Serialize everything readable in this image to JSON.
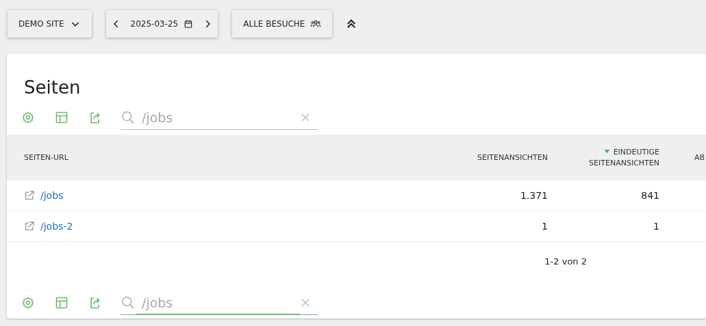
{
  "top_bar": {
    "site_button": "DEMO SITE",
    "date": "2025-03-25",
    "segment_button": "ALLE BESUCHE"
  },
  "card": {
    "title": "Seiten",
    "top_search": {
      "value": "/jobs",
      "focused": false
    },
    "table": {
      "columns": [
        {
          "label": "SEITEN-URL",
          "sorted": false
        },
        {
          "label": "SEITENANSICHTEN",
          "sorted": false
        },
        {
          "label": "EINDEUTIGE SEITENANSICHTEN",
          "sorted": true
        },
        {
          "label": "AB",
          "sorted": false
        }
      ],
      "rows": [
        {
          "url": "/jobs",
          "views": "1.371",
          "unique": "841"
        },
        {
          "url": "/jobs-2",
          "views": "1",
          "unique": "1"
        }
      ]
    },
    "pagination": "1-2 von 2",
    "bottom_search": {
      "value": "/jobs",
      "focused": true
    }
  }
}
